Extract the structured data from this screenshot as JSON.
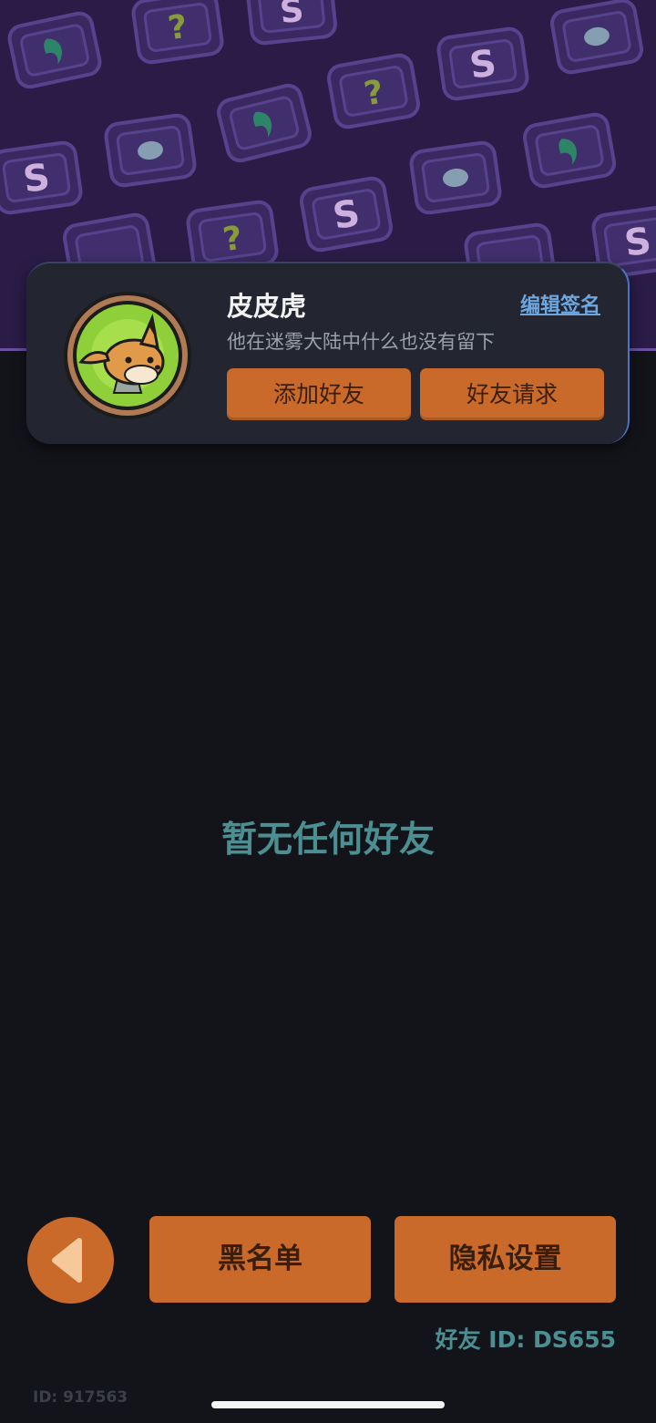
{
  "profile": {
    "nickname": "皮皮虎",
    "edit_signature_label": "编辑签名",
    "signature": "他在迷雾大陆中什么也没有留下",
    "add_friend_label": "添加好友",
    "friend_request_label": "好友请求"
  },
  "friends": {
    "empty_message": "暂无任何好友"
  },
  "bottom_bar": {
    "back_icon": "back-arrow-icon",
    "blacklist_label": "黑名单",
    "privacy_label": "隐私设置",
    "friend_id": "好友 ID: DS655"
  },
  "footer": {
    "user_id": "ID: 917563"
  },
  "colors": {
    "background": "#13141a",
    "banner": "#2a1c47",
    "accent_orange": "#c96a2a",
    "teal_text": "#4b8f93",
    "link_blue": "#6ea7e0"
  }
}
